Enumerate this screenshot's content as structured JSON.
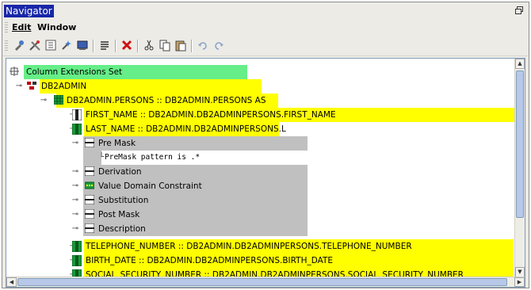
{
  "window": {
    "title": "Navigator",
    "restore_icon": "restore-icon"
  },
  "menu": {
    "edit": "Edit",
    "window": "Window"
  },
  "toolbar": {
    "icons": [
      "new-icon",
      "tools-icon",
      "tree-icon",
      "wizard-icon",
      "run-icon",
      "list-icon",
      "delete-icon",
      "cut-icon",
      "copy-icon",
      "paste-icon",
      "undo-icon",
      "redo-icon"
    ]
  },
  "tree": {
    "nodes": [
      {
        "label": "Column Extensions Set"
      },
      {
        "label": "DB2ADMIN"
      },
      {
        "label": "DB2ADMIN.PERSONS  ::  DB2ADMIN.PERSONS AS"
      },
      {
        "label": "FIRST_NAME  ::  DB2ADMIN.DB2ADMINPERSONS.FIRST_NAME"
      },
      {
        "label": "LAST_NAME  ::  DB2ADMIN.DB2ADMINPERSONS.L"
      },
      {
        "label": "Pre Mask"
      },
      {
        "label": "PreMask pattern is .*"
      },
      {
        "label": "Derivation"
      },
      {
        "label": "Value Domain Constraint"
      },
      {
        "label": "Substitution"
      },
      {
        "label": "Post Mask"
      },
      {
        "label": "Description"
      },
      {
        "label": "TELEPHONE_NUMBER  ::  DB2ADMIN.DB2ADMINPERSONS.TELEPHONE_NUMBER"
      },
      {
        "label": "BIRTH_DATE  ::  DB2ADMIN.DB2ADMINPERSONS.BIRTH_DATE"
      },
      {
        "label": "SOCIAL_SECURITY_NUMBER  ::  DB2ADMIN.DB2ADMINPERSONS.SOCIAL_SECURITY_NUMBER"
      }
    ]
  },
  "colors": {
    "highlight_yellow": "#ffff00",
    "highlight_green": "#66ee88",
    "selection_gray": "#c0c0c0",
    "title_blue": "#1826a8"
  }
}
